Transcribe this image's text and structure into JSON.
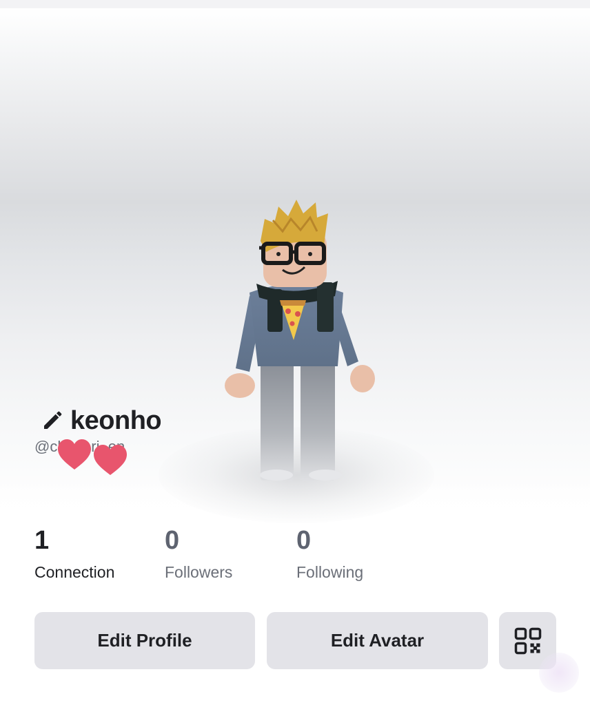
{
  "profile": {
    "display_name": "keonho",
    "username": "@ch   ri en"
  },
  "stats": {
    "connections": {
      "count": "1",
      "label": "Connection"
    },
    "followers": {
      "count": "0",
      "label": "Followers"
    },
    "following": {
      "count": "0",
      "label": "Following"
    }
  },
  "actions": {
    "edit_profile": "Edit Profile",
    "edit_avatar": "Edit Avatar",
    "qr_icon": "qr-code-icon"
  },
  "icons": {
    "edit_name": "pencil-icon",
    "sticker": "hearts-sticker"
  },
  "colors": {
    "button_bg": "#e3e3e8",
    "text_primary": "#1f2024",
    "text_secondary": "#6b6f78",
    "heart": "#e8556d"
  }
}
